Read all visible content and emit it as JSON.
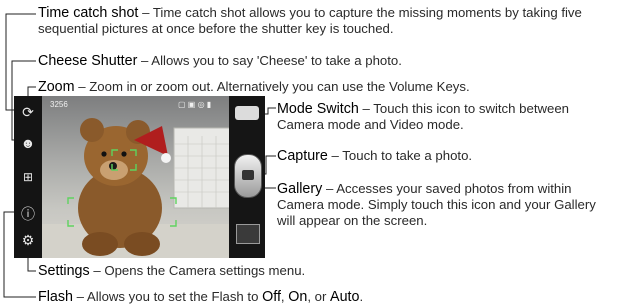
{
  "annotations": {
    "time_catch": {
      "title": "Time catch shot",
      "line1": "– Time catch shot allows you to capture the missing moments by taking five",
      "line2": "sequential pictures at once before the shutter key is touched."
    },
    "cheese": {
      "title": "Cheese Shutter",
      "text": "– Allows you to say 'Cheese' to take a photo."
    },
    "zoom": {
      "title": "Zoom",
      "text": "– Zoom in or zoom out. Alternatively you can use the Volume Keys."
    },
    "mode_switch": {
      "title": "Mode Switch",
      "line1": "– Touch this icon to switch between",
      "line2": "Camera mode and Video mode."
    },
    "capture": {
      "title": "Capture",
      "text": "– Touch to take a photo."
    },
    "gallery": {
      "title": "Gallery",
      "line1": "– Accesses your saved photos from within",
      "line2": "Camera mode. Simply touch this icon and your Gallery",
      "line3": "will appear on the screen."
    },
    "settings": {
      "title": "Settings",
      "text": "– Opens the Camera settings menu."
    },
    "flash": {
      "title": "Flash",
      "text_before": "– Allows you to set the Flash to ",
      "off": "Off",
      "sep1": ", ",
      "on": "On",
      "sep2": ", or ",
      "auto": "Auto",
      "end": "."
    }
  },
  "phone": {
    "status_count": "3256",
    "icons": {
      "time_catch": "time-catch-icon",
      "cheese": "cheese-shutter-icon",
      "zoom": "zoom-icon",
      "flash": "flash-icon",
      "settings": "gear-icon",
      "mode": "camera-mode-icon",
      "capture": "shutter-icon",
      "gallery": "gallery-thumbnail-icon"
    }
  }
}
